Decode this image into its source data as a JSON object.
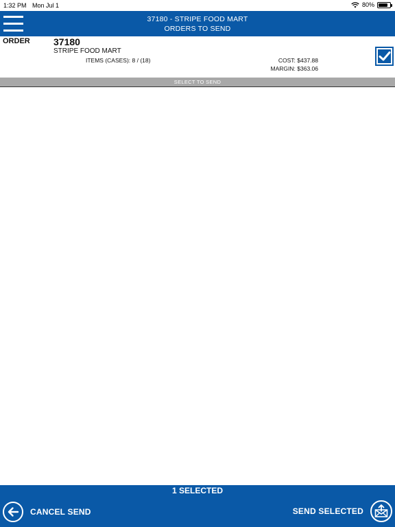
{
  "status_bar": {
    "time": "1:32 PM",
    "date": "Mon Jul 1",
    "battery": "80%",
    "battery_level": 0.8
  },
  "header": {
    "title": "37180 - STRIPE FOOD MART",
    "subtitle": "ORDERS TO SEND"
  },
  "order": {
    "label": "ORDER",
    "number": "37180",
    "store": "STRIPE FOOD MART",
    "items": "ITEMS (CASES): 8 / (18)",
    "cost": "COST: $437.88",
    "margin": "MARGIN: $363.06",
    "selected": true
  },
  "select_bar": {
    "label": "SELECT TO SEND"
  },
  "footer": {
    "selected_count": "1 SELECTED",
    "cancel_label": "CANCEL SEND",
    "send_label": "SEND SELECTED"
  },
  "colors": {
    "brand_blue": "#0a59a7",
    "select_bar_gray": "#a8a8a8"
  },
  "icons": {
    "menu": "hamburger-menu-icon",
    "check": "checkmark-icon",
    "back": "arrow-left-icon",
    "send": "envelope-upload-icon",
    "wifi": "wifi-icon",
    "battery": "battery-icon"
  }
}
